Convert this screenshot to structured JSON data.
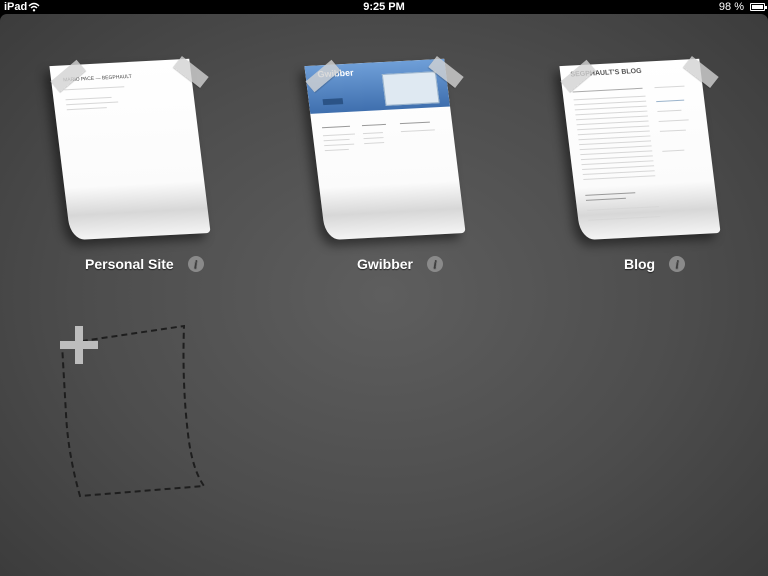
{
  "status_bar": {
    "carrier": "iPad",
    "time": "9:25 PM",
    "battery": "98 %"
  },
  "sites": [
    {
      "label": "Personal Site",
      "thumbnail_title": "MARIO PACE — BEGPHAULT"
    },
    {
      "label": "Gwibber",
      "thumbnail_title": "Gwibber"
    },
    {
      "label": "Blog",
      "thumbnail_title": "SEGPHAULT'S BLOG"
    }
  ],
  "add_button_icon": "plus-icon",
  "info_icon_glyph": "i",
  "colors": {
    "background": "#4f4f4f",
    "gwibber_header": "#4f7fbf",
    "label": "#ffffff"
  }
}
